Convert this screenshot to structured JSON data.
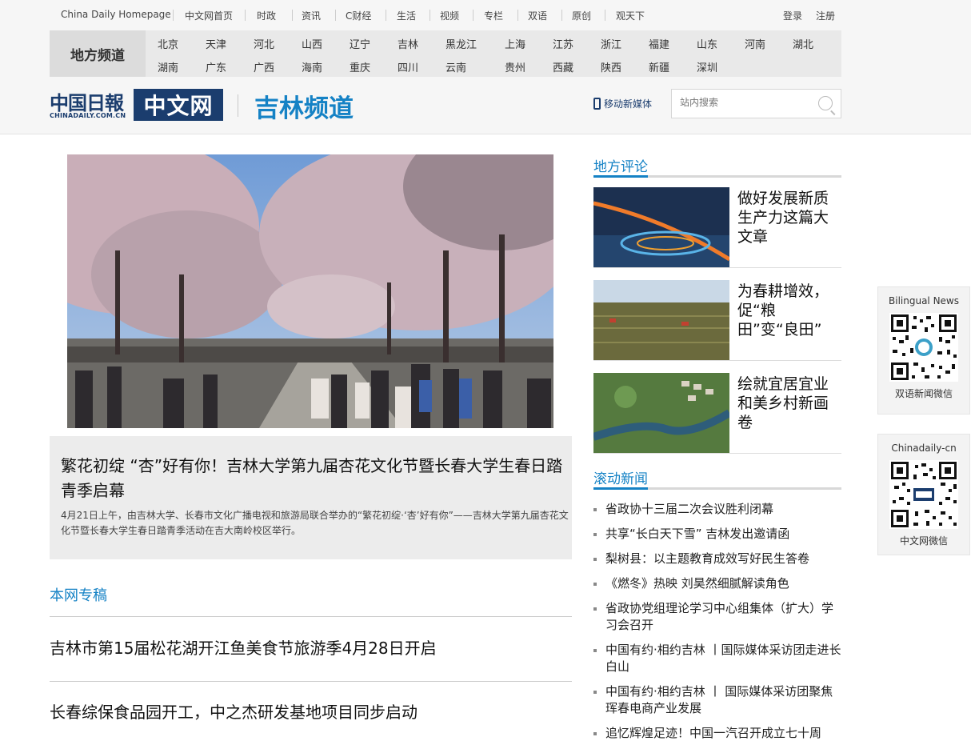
{
  "topnav": {
    "items": [
      "China Daily Homepage",
      "中文网首页",
      "时政",
      "资讯",
      "C财经",
      "生活",
      "视频",
      "专栏",
      "双语",
      "原创",
      "观天下"
    ],
    "login": "登录",
    "register": "注册"
  },
  "regions": {
    "label": "地方频道",
    "row1": [
      "北京",
      "天津",
      "河北",
      "山西",
      "辽宁",
      "吉林",
      "黑龙江",
      "上海",
      "江苏",
      "浙江",
      "福建",
      "山东",
      "河南",
      "湖北"
    ],
    "row2": [
      "湖南",
      "广东",
      "广西",
      "海南",
      "重庆",
      "四川",
      "云南",
      "贵州",
      "西藏",
      "陕西",
      "新疆",
      "深圳"
    ]
  },
  "brand": {
    "logo_cn": "中国日報",
    "logo_en": "CHINADAILY.COM.CN",
    "logo_cw": "中文网",
    "channel": "吉林频道"
  },
  "header": {
    "mobile": "移动新媒体",
    "search_placeholder": "站内搜索"
  },
  "hero": {
    "title": "繁花初绽 “杏”好有你！吉林大学第九届杏花文化节暨长春大学生春日踏青季启幕",
    "desc": "4月21日上午，由吉林大学、长春市文化广播电视和旅游局联合举办的“繁花初绽·‘杏’好有你”——吉林大学第九届杏花文化节暨长春大学生春日踏青季活动在吉大南岭校区举行。"
  },
  "features": {
    "title": "本网专稿",
    "items": [
      "吉林市第15届松花湖开江鱼美食节旅游季4月28日开启",
      "长春综保食品园开工，中之杰研发基地项目同步启动"
    ]
  },
  "comments": {
    "title": "地方评论",
    "items": [
      "做好发展新质生产力这篇大文章",
      "为春耕增效，促“粮田”变“良田”",
      "绘就宜居宜业和美乡村新画卷"
    ]
  },
  "news": {
    "title": "滚动新闻",
    "items": [
      "省政协十三届二次会议胜利闭幕",
      "共享“长白天下雪” 吉林发出邀请函",
      "梨树县：以主题教育成效写好民生答卷",
      "《燃冬》热映 刘昊然细腻解读角色",
      "省政协党组理论学习中心组集体（扩大）学习会召开",
      "中国有约·相约吉林 丨国际媒体采访团走进长白山",
      "中国有约·相约吉林 丨 国际媒体采访团聚焦珲春电商产业发展",
      "追忆辉煌足迹！中国一汽召开成立七十周"
    ]
  },
  "qr": {
    "bilingual_top": "Bilingual News",
    "bilingual_bottom": "双语新闻微信",
    "cd_top": "Chinadaily-cn",
    "cd_bottom": "中文网微信"
  }
}
